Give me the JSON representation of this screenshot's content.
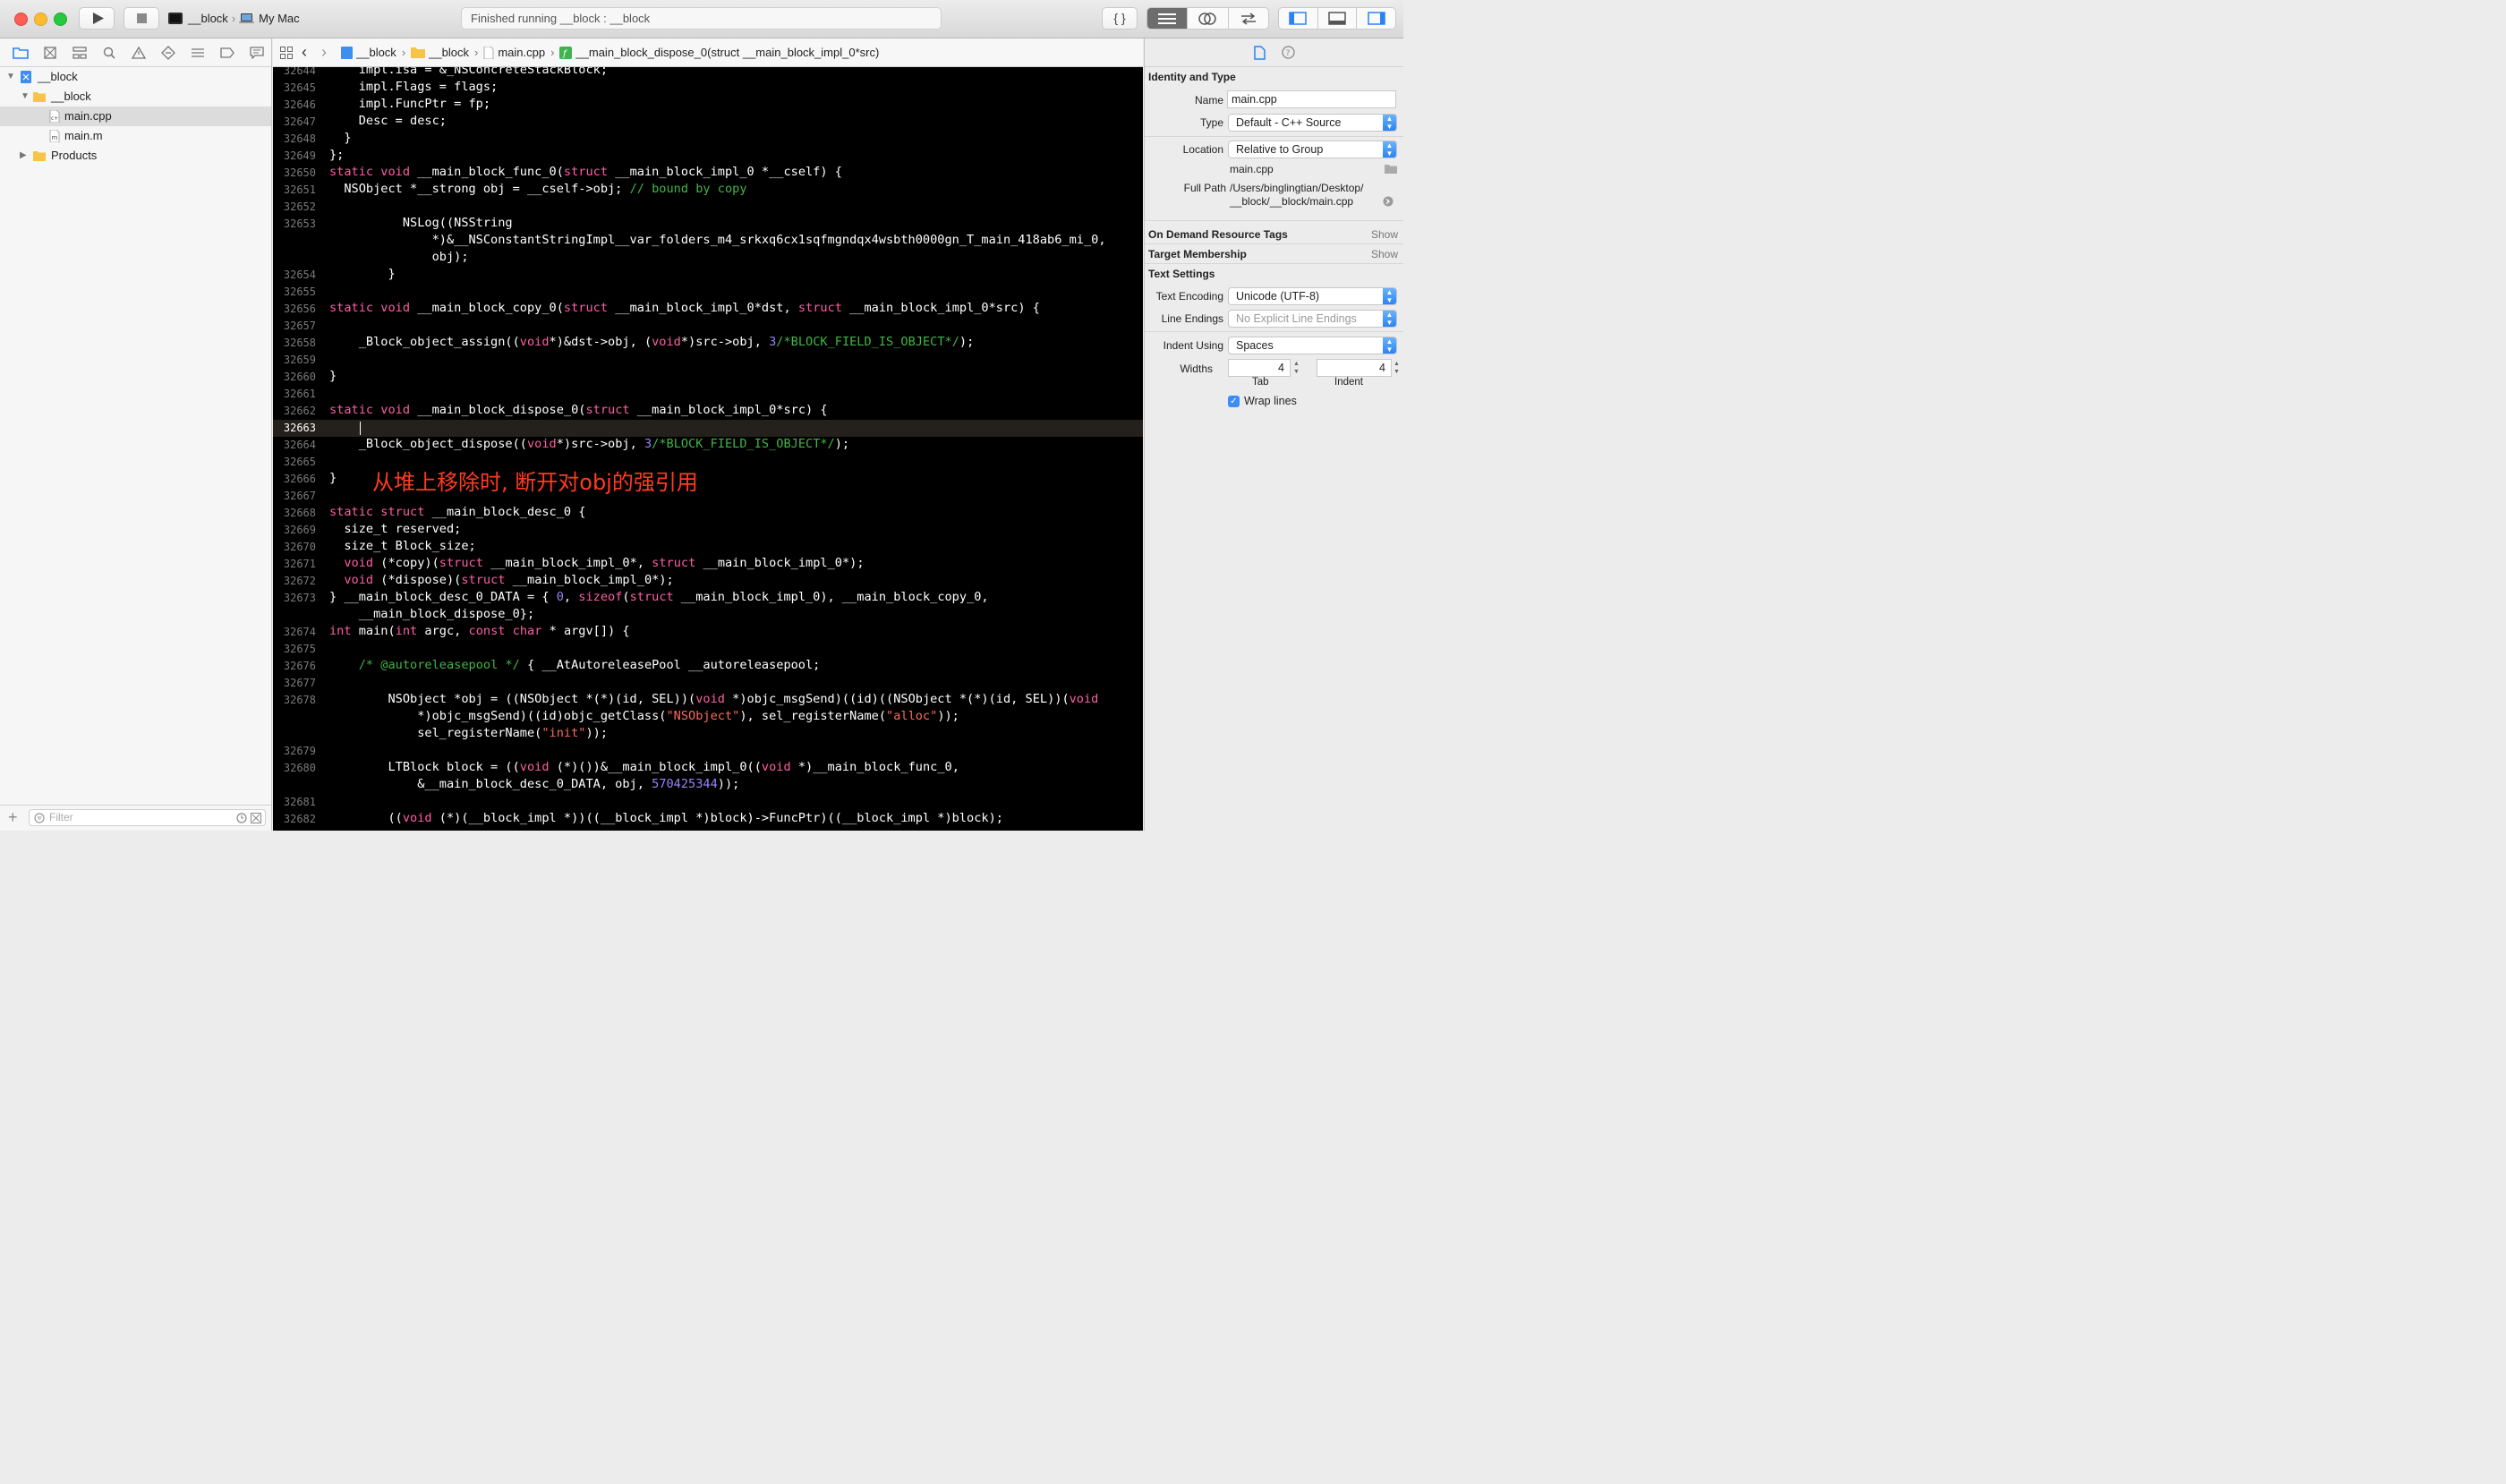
{
  "toolbar": {
    "scheme_name": "__block",
    "destination": "My Mac",
    "activity_status": "Finished running __block : __block",
    "editor_mode_labels": [
      "{ }"
    ]
  },
  "navigator": {
    "tree": [
      {
        "label": "__block",
        "kind": "project",
        "expanded": true,
        "selected": false
      },
      {
        "label": "__block",
        "kind": "folder",
        "expanded": true,
        "selected": false
      },
      {
        "label": "main.cpp",
        "kind": "cpp-file",
        "selected": true
      },
      {
        "label": "main.m",
        "kind": "m-file",
        "selected": false
      },
      {
        "label": "Products",
        "kind": "folder",
        "expanded": false,
        "selected": false
      }
    ],
    "filter_placeholder": "Filter"
  },
  "jumpbar": {
    "crumbs": [
      "__block",
      "__block",
      "main.cpp",
      "__main_block_dispose_0(struct __main_block_impl_0*src)"
    ]
  },
  "editor": {
    "current_line": "32663",
    "annotation": "从堆上移除时, 断开对obj的强引用",
    "lines": [
      {
        "num": "32644",
        "spans": [
          [
            "",
            "    impl.isa = &_NSConcreteStackBlock;"
          ]
        ]
      },
      {
        "num": "32645",
        "spans": [
          [
            "",
            "    impl.Flags = flags;"
          ]
        ]
      },
      {
        "num": "32646",
        "spans": [
          [
            "",
            "    impl.FuncPtr = fp;"
          ]
        ]
      },
      {
        "num": "32647",
        "spans": [
          [
            "",
            "    Desc = desc;"
          ]
        ]
      },
      {
        "num": "32648",
        "spans": [
          [
            "",
            "  }"
          ]
        ]
      },
      {
        "num": "32649",
        "spans": [
          [
            "",
            "};"
          ]
        ]
      },
      {
        "num": "32650",
        "spans": [
          [
            "k",
            "static"
          ],
          [
            "",
            " "
          ],
          [
            "k",
            "void"
          ],
          [
            "",
            " __main_block_func_0("
          ],
          [
            "k",
            "struct"
          ],
          [
            "",
            " __main_block_impl_0 *__cself) {"
          ]
        ]
      },
      {
        "num": "32651",
        "spans": [
          [
            "",
            "  NSObject *__strong obj = __cself->obj; "
          ],
          [
            "c",
            "// bound by copy"
          ]
        ]
      },
      {
        "num": "32652",
        "spans": [
          [
            "",
            ""
          ]
        ]
      },
      {
        "num": "32653",
        "spans": [
          [
            "",
            "          NSLog((NSString"
          ]
        ]
      },
      {
        "num": "",
        "spans": [
          [
            "",
            "              *)&__NSConstantStringImpl__var_folders_m4_srkxq6cx1sqfmgndqx4wsbth0000gn_T_main_418ab6_mi_0,"
          ]
        ]
      },
      {
        "num": "",
        "spans": [
          [
            "",
            "              obj);"
          ]
        ]
      },
      {
        "num": "32654",
        "spans": [
          [
            "",
            "        }"
          ]
        ]
      },
      {
        "num": "32655",
        "spans": [
          [
            "",
            ""
          ]
        ]
      },
      {
        "num": "32656",
        "spans": [
          [
            "k",
            "static"
          ],
          [
            "",
            " "
          ],
          [
            "k",
            "void"
          ],
          [
            "",
            " __main_block_copy_0("
          ],
          [
            "k",
            "struct"
          ],
          [
            "",
            " __main_block_impl_0*dst, "
          ],
          [
            "k",
            "struct"
          ],
          [
            "",
            " __main_block_impl_0*src) {"
          ]
        ]
      },
      {
        "num": "32657",
        "spans": [
          [
            "",
            ""
          ]
        ]
      },
      {
        "num": "32658",
        "spans": [
          [
            "",
            "    _Block_object_assign(("
          ],
          [
            "k",
            "void"
          ],
          [
            "",
            "*)&dst->obj, ("
          ],
          [
            "k",
            "void"
          ],
          [
            "",
            "*)src->obj, "
          ],
          [
            "n",
            "3"
          ],
          [
            "c",
            "/*BLOCK_FIELD_IS_OBJECT*/"
          ],
          [
            "",
            ");"
          ]
        ]
      },
      {
        "num": "32659",
        "spans": [
          [
            "",
            ""
          ]
        ]
      },
      {
        "num": "32660",
        "spans": [
          [
            "",
            "}"
          ]
        ]
      },
      {
        "num": "32661",
        "spans": [
          [
            "",
            ""
          ]
        ]
      },
      {
        "num": "32662",
        "spans": [
          [
            "k",
            "static"
          ],
          [
            "",
            " "
          ],
          [
            "k",
            "void"
          ],
          [
            "",
            " __main_block_dispose_0("
          ],
          [
            "k",
            "struct"
          ],
          [
            "",
            " __main_block_impl_0*src) {"
          ]
        ]
      },
      {
        "num": "32663",
        "spans": [
          [
            "",
            ""
          ]
        ]
      },
      {
        "num": "32664",
        "spans": [
          [
            "",
            "    _Block_object_dispose(("
          ],
          [
            "k",
            "void"
          ],
          [
            "",
            "*)src->obj, "
          ],
          [
            "n",
            "3"
          ],
          [
            "c",
            "/*BLOCK_FIELD_IS_OBJECT*/"
          ],
          [
            "",
            ");"
          ]
        ]
      },
      {
        "num": "32665",
        "spans": [
          [
            "",
            ""
          ]
        ]
      },
      {
        "num": "32666",
        "spans": [
          [
            "",
            "}"
          ]
        ]
      },
      {
        "num": "32667",
        "spans": [
          [
            "",
            ""
          ]
        ]
      },
      {
        "num": "32668",
        "spans": [
          [
            "k",
            "static"
          ],
          [
            "",
            " "
          ],
          [
            "k",
            "struct"
          ],
          [
            "",
            " __main_block_desc_0 {"
          ]
        ]
      },
      {
        "num": "32669",
        "spans": [
          [
            "",
            "  size_t reserved;"
          ]
        ]
      },
      {
        "num": "32670",
        "spans": [
          [
            "",
            "  size_t Block_size;"
          ]
        ]
      },
      {
        "num": "32671",
        "spans": [
          [
            "",
            "  "
          ],
          [
            "k",
            "void"
          ],
          [
            "",
            " (*copy)("
          ],
          [
            "k",
            "struct"
          ],
          [
            "",
            " __main_block_impl_0*, "
          ],
          [
            "k",
            "struct"
          ],
          [
            "",
            " __main_block_impl_0*);"
          ]
        ]
      },
      {
        "num": "32672",
        "spans": [
          [
            "",
            "  "
          ],
          [
            "k",
            "void"
          ],
          [
            "",
            " (*dispose)("
          ],
          [
            "k",
            "struct"
          ],
          [
            "",
            " __main_block_impl_0*);"
          ]
        ]
      },
      {
        "num": "32673",
        "spans": [
          [
            "",
            "} __main_block_desc_0_DATA = { "
          ],
          [
            "n",
            "0"
          ],
          [
            "",
            ", "
          ],
          [
            "k",
            "sizeof"
          ],
          [
            "",
            "("
          ],
          [
            "k",
            "struct"
          ],
          [
            "",
            " __main_block_impl_0), __main_block_copy_0,"
          ]
        ]
      },
      {
        "num": "",
        "spans": [
          [
            "",
            "    __main_block_dispose_0};"
          ]
        ]
      },
      {
        "num": "32674",
        "spans": [
          [
            "k",
            "int"
          ],
          [
            "",
            " main("
          ],
          [
            "k",
            "int"
          ],
          [
            "",
            " argc, "
          ],
          [
            "k",
            "const"
          ],
          [
            "",
            " "
          ],
          [
            "k",
            "char"
          ],
          [
            "",
            " * argv[]) {"
          ]
        ]
      },
      {
        "num": "32675",
        "spans": [
          [
            "",
            ""
          ]
        ]
      },
      {
        "num": "32676",
        "spans": [
          [
            "",
            "    "
          ],
          [
            "c",
            "/* @autoreleasepool */"
          ],
          [
            "",
            " { __AtAutoreleasePool __autoreleasepool;"
          ]
        ]
      },
      {
        "num": "32677",
        "spans": [
          [
            "",
            ""
          ]
        ]
      },
      {
        "num": "32678",
        "spans": [
          [
            "",
            "        NSObject *obj = ((NSObject *(*)(id, SEL))("
          ],
          [
            "k",
            "void"
          ],
          [
            "",
            " *)objc_msgSend)((id)((NSObject *(*)(id, SEL))("
          ],
          [
            "k",
            "void"
          ]
        ]
      },
      {
        "num": "",
        "spans": [
          [
            "",
            "            *)objc_msgSend)((id)objc_getClass("
          ],
          [
            "s",
            "\"NSObject\""
          ],
          [
            "",
            "), sel_registerName("
          ],
          [
            "s",
            "\"alloc\""
          ],
          [
            "",
            "));"
          ]
        ]
      },
      {
        "num": "",
        "spans": [
          [
            "",
            "            sel_registerName("
          ],
          [
            "s",
            "\"init\""
          ],
          [
            "",
            "));"
          ]
        ]
      },
      {
        "num": "32679",
        "spans": [
          [
            "",
            ""
          ]
        ]
      },
      {
        "num": "32680",
        "spans": [
          [
            "",
            "        LTBlock block = (("
          ],
          [
            "k",
            "void"
          ],
          [
            "",
            " (*)())&__main_block_impl_0(("
          ],
          [
            "k",
            "void"
          ],
          [
            "",
            " *)__main_block_func_0,"
          ]
        ]
      },
      {
        "num": "",
        "spans": [
          [
            "",
            "            &__main_block_desc_0_DATA, obj, "
          ],
          [
            "n",
            "570425344"
          ],
          [
            "",
            "));"
          ]
        ]
      },
      {
        "num": "32681",
        "spans": [
          [
            "",
            ""
          ]
        ]
      },
      {
        "num": "32682",
        "spans": [
          [
            "",
            "        (("
          ],
          [
            "k",
            "void"
          ],
          [
            "",
            " (*)(__block_impl *))((__block_impl *)block)->FuncPtr)((__block_impl *)block);"
          ]
        ]
      }
    ]
  },
  "inspector": {
    "identity_title": "Identity and Type",
    "name_label": "Name",
    "name_value": "main.cpp",
    "type_label": "Type",
    "type_value": "Default - C++ Source",
    "location_label": "Location",
    "location_value": "Relative to Group",
    "location_file": "main.cpp",
    "fullpath_label": "Full Path",
    "fullpath_line1": "/Users/binglingtian/Desktop/",
    "fullpath_line2": "__block/__block/main.cpp",
    "on_demand_title": "On Demand Resource Tags",
    "target_title": "Target Membership",
    "show_label": "Show",
    "text_settings_title": "Text Settings",
    "encoding_label": "Text Encoding",
    "encoding_value": "Unicode (UTF-8)",
    "line_endings_label": "Line Endings",
    "line_endings_placeholder": "No Explicit Line Endings",
    "indent_using_label": "Indent Using",
    "indent_using_value": "Spaces",
    "widths_label": "Widths",
    "tab_width": "4",
    "indent_width": "4",
    "tab_caption": "Tab",
    "indent_caption": "Indent",
    "wrap_lines_label": "Wrap lines",
    "wrap_lines_checked": true
  }
}
